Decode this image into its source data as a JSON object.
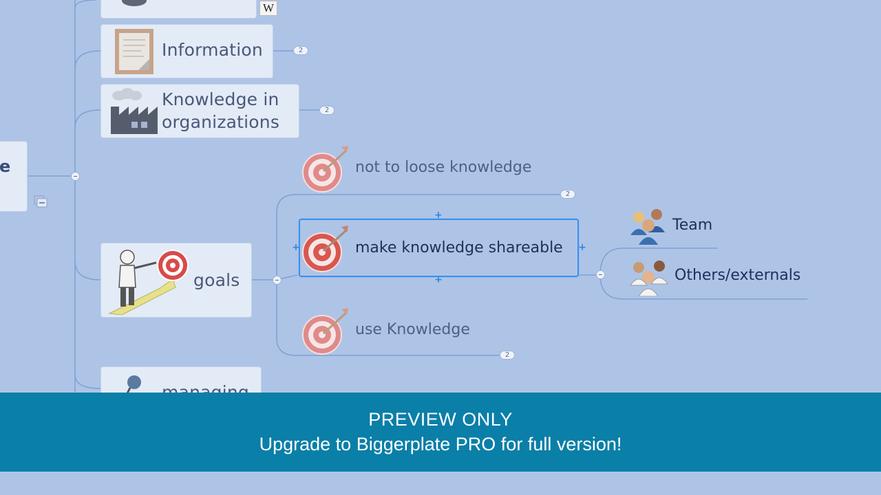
{
  "nodes": {
    "information": {
      "label": "Information",
      "count": "2"
    },
    "knowledge_org": {
      "line1": "Knowledge in",
      "line2": "organizations",
      "count": "2"
    },
    "root_partial": {
      "label": "e"
    },
    "goals": {
      "label": "goals"
    },
    "managing": {
      "label": "managing"
    },
    "wikipedia_badge": {
      "label": "W"
    }
  },
  "goals_children": [
    {
      "label": "not to loose knowledge",
      "count": "2"
    },
    {
      "label": "make knowledge shareable"
    },
    {
      "label": "use Knowledge",
      "count": "2"
    }
  ],
  "shareable_children": [
    {
      "label": "Team"
    },
    {
      "label": "Others/externals"
    }
  ],
  "banner": {
    "line1": "PREVIEW ONLY",
    "line2": "Upgrade to Biggerplate PRO for full version!"
  },
  "colors": {
    "background": "#aec4e6",
    "node_fill": "#e3ebf7",
    "selection": "#3f8ee6",
    "banner": "#0a7fa8"
  }
}
